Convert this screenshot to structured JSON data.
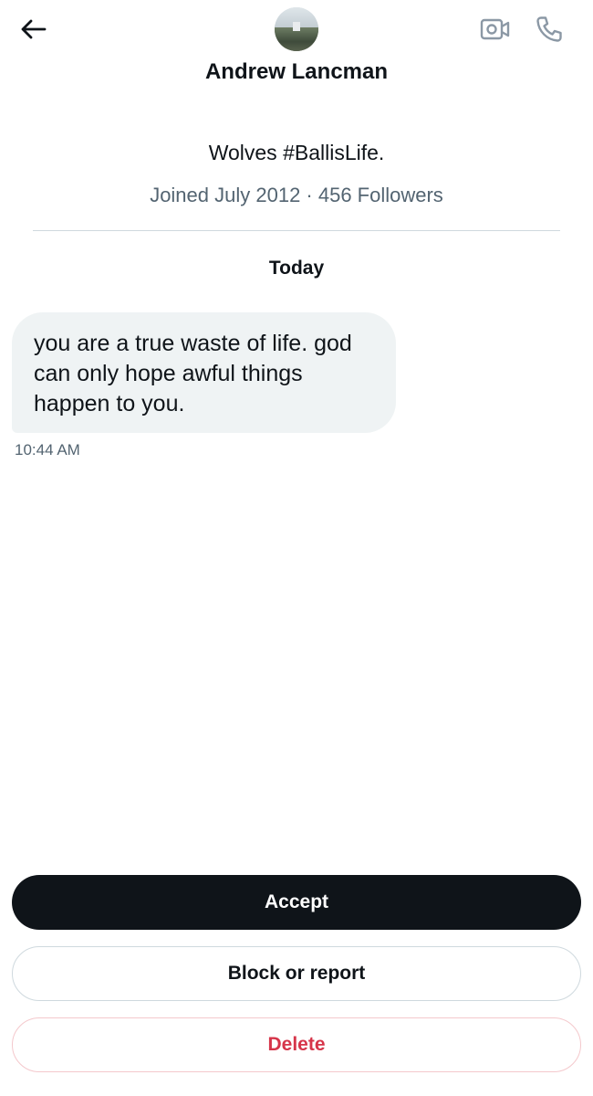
{
  "header": {
    "back_icon": "arrow-left-icon",
    "video_icon": "video-camera-icon",
    "call_icon": "phone-icon",
    "name": "Andrew Lancman"
  },
  "profile": {
    "bio": "Wolves #BallisLife.",
    "meta": "Joined July 2012 · 456 Followers"
  },
  "conversation": {
    "day_label": "Today",
    "messages": [
      {
        "text": "you are a true waste of life. god can only hope awful things happen to you.",
        "time": "10:44 AM"
      }
    ]
  },
  "actions": {
    "accept_label": "Accept",
    "block_label": "Block or report",
    "delete_label": "Delete"
  },
  "colors": {
    "primary_text": "#0f1419",
    "secondary_text": "#536471",
    "bubble_bg": "#eff3f4",
    "divider": "#cfd9de",
    "delete_red": "#d6354a"
  }
}
